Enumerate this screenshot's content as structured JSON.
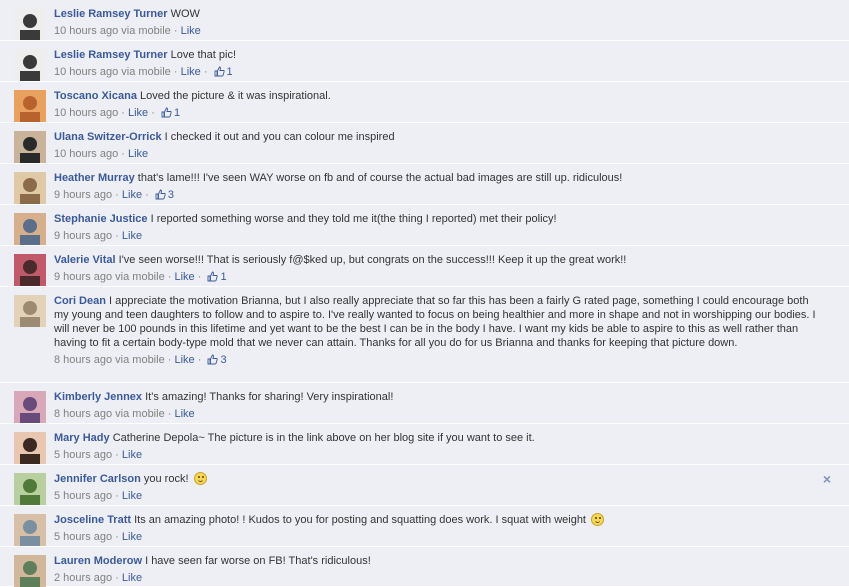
{
  "comments": [
    {
      "author": "Leslie Ramsey Turner",
      "text": "WOW",
      "time": "10 hours ago",
      "via": " via mobile",
      "like": "Like",
      "likes": "",
      "avatar": "#3a3a3a",
      "avatar2": "#eeeeee",
      "emoji": false
    },
    {
      "author": "Leslie Ramsey Turner",
      "text": "Love that pic!",
      "time": "10 hours ago",
      "via": " via mobile",
      "like": "Like",
      "likes": "1",
      "avatar": "#3a3a3a",
      "avatar2": "#eeeeee",
      "emoji": false
    },
    {
      "author": "Toscano Xicana",
      "text": "Loved the picture & it was inspirational.",
      "time": "10 hours ago",
      "via": "",
      "like": "Like",
      "likes": "1",
      "avatar": "#b8632e",
      "avatar2": "#e8a15f",
      "emoji": false
    },
    {
      "author": "Ulana Switzer-Orrick",
      "text": "I checked it out and you can colour me inspired",
      "time": "10 hours ago",
      "via": "",
      "like": "Like",
      "likes": "",
      "avatar": "#2a2a2a",
      "avatar2": "#c9b39a",
      "emoji": false
    },
    {
      "author": "Heather Murray",
      "text": "that's lame!!! I've seen WAY worse on fb and of course the actual bad images are still up. ridiculous!",
      "time": "9 hours ago",
      "via": "",
      "like": "Like",
      "likes": "3",
      "avatar": "#8b6b4a",
      "avatar2": "#e0c9a6",
      "emoji": false
    },
    {
      "author": "Stephanie Justice",
      "text": "I reported something worse and they told me it(the thing I reported) met their policy!",
      "time": "9 hours ago",
      "via": "",
      "like": "Like",
      "likes": "",
      "avatar": "#5b6f8a",
      "avatar2": "#d6b08c",
      "emoji": false
    },
    {
      "author": "Valerie Vital",
      "text": "I've seen worse!!! That is seriously f@$ked up, but congrats on the success!!! Keep it up the great work!!",
      "time": "9 hours ago",
      "via": " via mobile",
      "like": "Like",
      "likes": "1",
      "avatar": "#4a2a2a",
      "avatar2": "#c0596a",
      "emoji": false
    },
    {
      "author": "Cori Dean",
      "text": "I appreciate the motivation Brianna, but I also really appreciate that so far this has been a fairly G rated page, something I could encourage both my young and teen daughters to follow and to aspire to. I've really wanted to focus on being healthier and more in shape and not in worshipping our bodies. I will never be 100 pounds in this lifetime and yet want to be the best I can be in the body I have. I want my kids be able to aspire to this as well rather than having to fit a certain body-type mold that we never can attain. Thanks for all you do for us Brianna and thanks for keeping that picture down.",
      "time": "8 hours ago",
      "via": " via mobile",
      "like": "Like",
      "likes": "3",
      "avatar": "#9c8a72",
      "avatar2": "#e2d2b8",
      "emoji": false
    },
    {
      "author": "Kimberly Jennex",
      "text": "It's amazing! Thanks for sharing! Very inspirational!",
      "time": "8 hours ago",
      "via": " via mobile",
      "like": "Like",
      "likes": "",
      "avatar": "#6a4a7a",
      "avatar2": "#d9a8b8",
      "emoji": false
    },
    {
      "author": "Mary Hady",
      "text": "Catherine Depola~ The picture is in the link above on her blog site if you want to see it.",
      "time": "5 hours ago",
      "via": "",
      "like": "Like",
      "likes": "",
      "avatar": "#3b2a22",
      "avatar2": "#e8c6b0",
      "emoji": false
    },
    {
      "author": "Jennifer Carlson",
      "text": "you rock!",
      "time": "5 hours ago",
      "via": "",
      "like": "Like",
      "likes": "",
      "avatar": "#4f7a3a",
      "avatar2": "#b8cfa0",
      "emoji": true
    },
    {
      "author": "Josceline Tratt",
      "text": "Its an amazing photo! ! Kudos to you for posting and squatting does work. I squat with weight",
      "time": "5 hours ago",
      "via": "",
      "like": "Like",
      "likes": "",
      "avatar": "#7a8fa0",
      "avatar2": "#d8c0a8",
      "emoji": true
    },
    {
      "author": "Lauren Moderow",
      "text": "I have seen far worse on FB! That's ridiculous!",
      "time": "2 hours ago",
      "via": "",
      "like": "Like",
      "likes": "",
      "avatar": "#5f7f5a",
      "avatar2": "#d2b89a",
      "emoji": false
    }
  ],
  "close_glyph": "×"
}
